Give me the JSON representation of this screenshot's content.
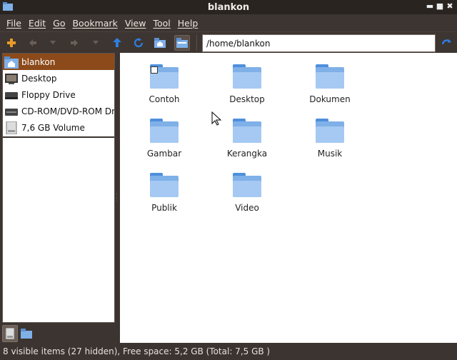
{
  "window": {
    "title": "blankon"
  },
  "menu": [
    {
      "label": "File"
    },
    {
      "label": "Edit"
    },
    {
      "label": "Go"
    },
    {
      "label": "Bookmark"
    },
    {
      "label": "View"
    },
    {
      "label": "Tool"
    },
    {
      "label": "Help"
    }
  ],
  "toolbar": {
    "location": "/home/blankon",
    "icons": [
      "new-tab-icon",
      "back-icon",
      "back-history-icon",
      "forward-icon",
      "forward-history-icon",
      "up-icon",
      "reload-icon",
      "home-icon",
      "places-icon",
      "go-icon"
    ]
  },
  "places": [
    {
      "label": "blankon",
      "icon": "home-folder-icon",
      "selected": true
    },
    {
      "label": "Desktop",
      "icon": "desktop-icon"
    },
    {
      "label": "Floppy Drive",
      "icon": "floppy-icon"
    },
    {
      "label": "CD-ROM/DVD-ROM Dr",
      "icon": "cdrom-icon"
    },
    {
      "label": "7,6 GB Volume",
      "icon": "volume-icon"
    }
  ],
  "files": [
    {
      "label": "Contoh",
      "icon": "folder-icon",
      "link": true
    },
    {
      "label": "Desktop",
      "icon": "folder-icon"
    },
    {
      "label": "Dokumen",
      "icon": "folder-icon"
    },
    {
      "label": "Gambar",
      "icon": "folder-icon"
    },
    {
      "label": "Kerangka",
      "icon": "folder-icon"
    },
    {
      "label": "Musik",
      "icon": "folder-icon"
    },
    {
      "label": "Publik",
      "icon": "folder-icon"
    },
    {
      "label": "Video",
      "icon": "folder-icon"
    }
  ],
  "status": "8 visible items (27 hidden), Free space: 5,2 GB (Total: 7,5 GB )",
  "colors": {
    "selection": "#8c4a1a",
    "folder": "#7fb0e8",
    "chrome": "#3b3430"
  }
}
